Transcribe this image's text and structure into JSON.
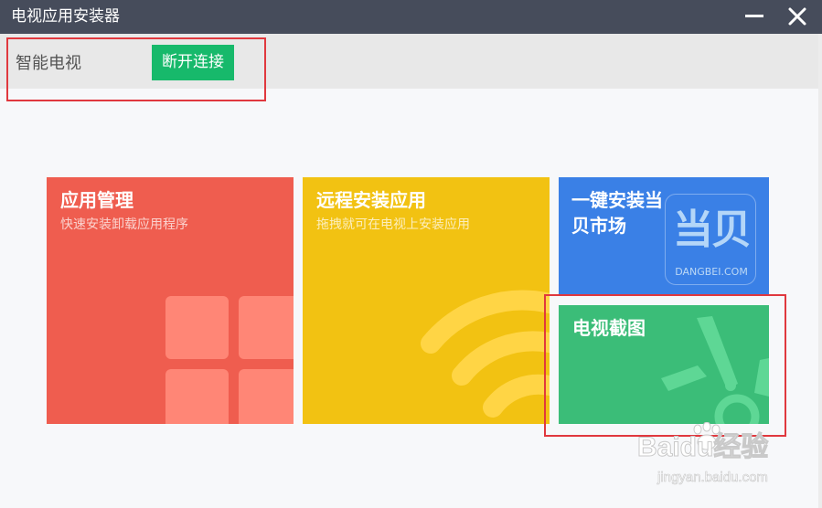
{
  "window": {
    "title": "电视应用安装器"
  },
  "connection": {
    "device_name": "智能电视",
    "disconnect_label": "断开连接"
  },
  "tiles": {
    "app_manage": {
      "title": "应用管理",
      "subtitle": "快速安装卸载应用程序"
    },
    "remote_install": {
      "title": "远程安装应用",
      "subtitle": "拖拽就可在电视上安装应用"
    },
    "market": {
      "title": "一键安装当贝市场",
      "logo_cn": "当贝",
      "logo_en": "DANGBEI.COM"
    },
    "screenshot": {
      "title": "电视截图"
    }
  },
  "watermark": {
    "logo": "Baidu经验",
    "url": "jingyan.baidu.com"
  },
  "colors": {
    "titlebar": "#464c5b",
    "disconnect_button": "#17b96b",
    "app_tile": "#ef5d4f",
    "remote_tile": "#f2c212",
    "market_tile": "#3a80e6",
    "screenshot_tile": "#3bbd78",
    "highlight": "#e0383e"
  },
  "icons": [
    "minimize-icon",
    "close-icon",
    "grid-icon",
    "wifi-icon",
    "dangbei-logo",
    "scissors-icon"
  ]
}
